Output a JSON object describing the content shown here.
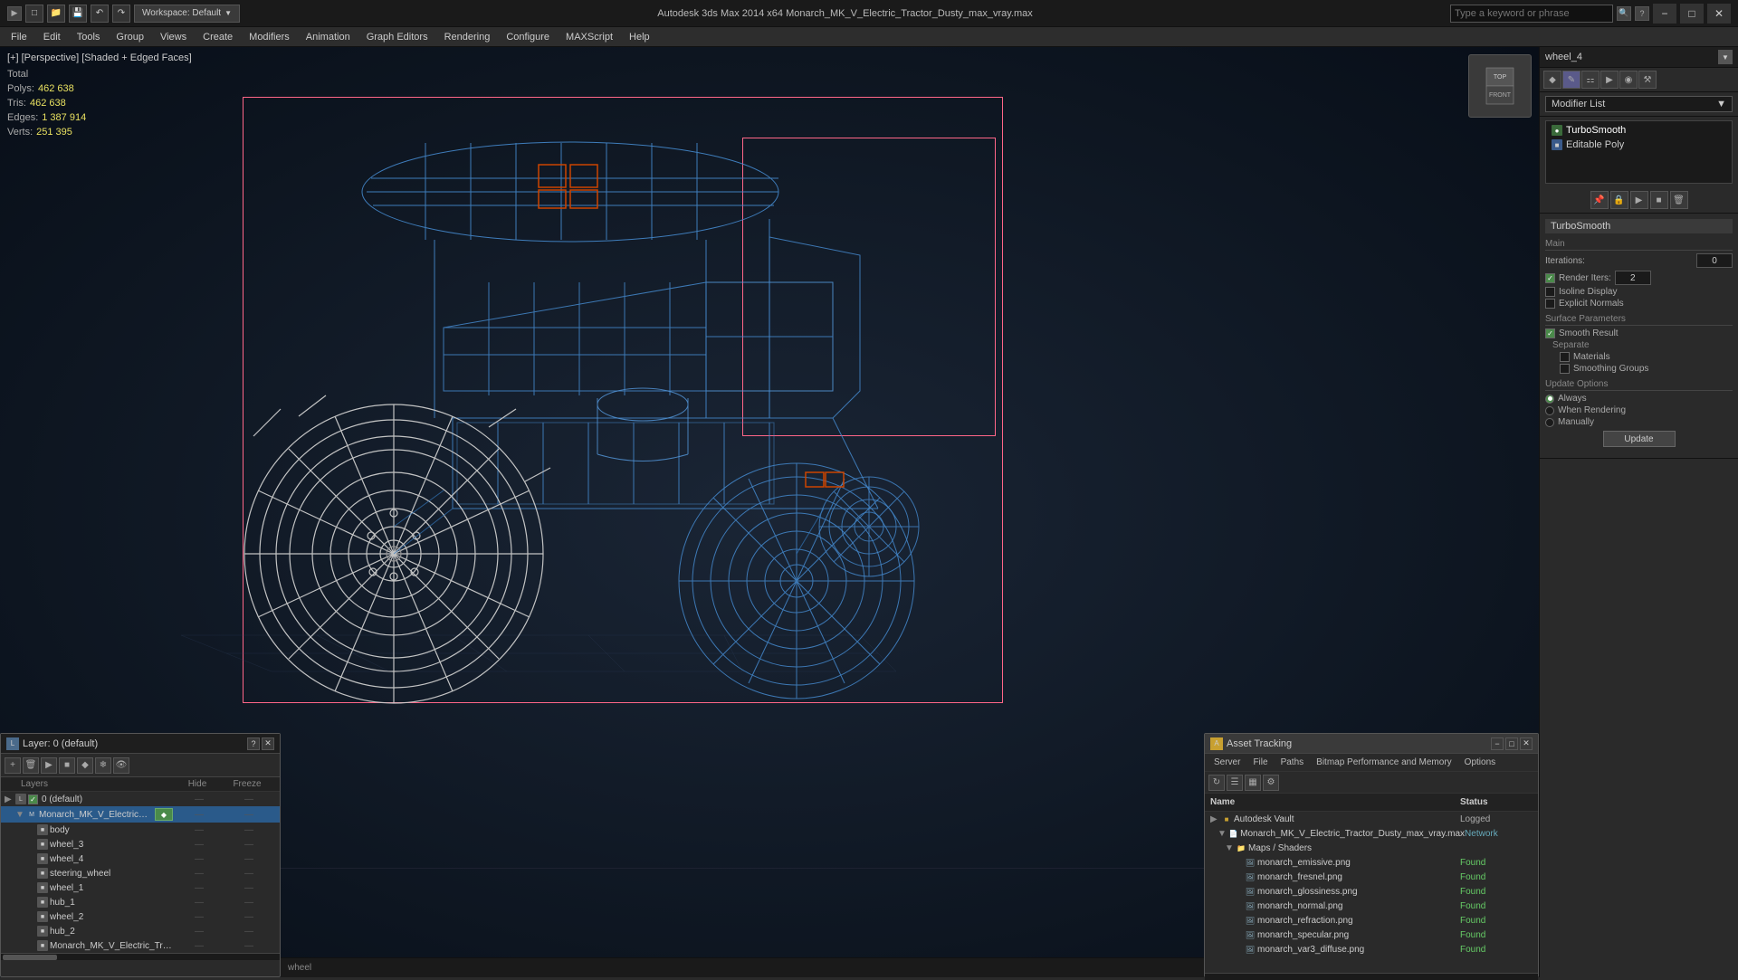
{
  "titlebar": {
    "title": "Autodesk 3ds Max 2014 x64    Monarch_MK_V_Electric_Tractor_Dusty_max_vray.max",
    "workspace_label": "Workspace: Default",
    "search_placeholder": "Type a keyword or phrase"
  },
  "menubar": {
    "items": [
      "File",
      "Edit",
      "Tools",
      "Group",
      "Views",
      "Create",
      "Modifiers",
      "Animation",
      "Graph Editors",
      "Rendering",
      "Configure",
      "MAXScript",
      "Help"
    ]
  },
  "viewport": {
    "label": "[+] [Perspective] [Shaded + Edged Faces]",
    "stats": {
      "total_label": "Total",
      "polys_label": "Polys:",
      "polys_value": "462 638",
      "tris_label": "Tris:",
      "tris_value": "462 638",
      "edges_label": "Edges:",
      "edges_value": "1 387 914",
      "verts_label": "Verts:",
      "verts_value": "251 395"
    }
  },
  "right_panel": {
    "object_name": "wheel_4",
    "modifier_list_label": "Modifier List",
    "modifiers": [
      {
        "name": "TurboSmooth",
        "type": "modifier"
      },
      {
        "name": "Editable Poly",
        "type": "base"
      }
    ],
    "turbosmooth": {
      "title": "TurboSmooth",
      "main_label": "Main",
      "iterations_label": "Iterations:",
      "iterations_value": "0",
      "render_iters_label": "Render Iters:",
      "render_iters_value": "2",
      "isoline_display_label": "Isoline Display",
      "isoline_checked": false,
      "explicit_normals_label": "Explicit Normals",
      "explicit_normals_checked": false,
      "surface_params_label": "Surface Parameters",
      "smooth_result_label": "Smooth Result",
      "smooth_result_checked": true,
      "separate_label": "Separate",
      "materials_label": "Materials",
      "materials_checked": false,
      "smoothing_groups_label": "Smoothing Groups",
      "smoothing_groups_checked": false,
      "update_options_label": "Update Options",
      "always_label": "Always",
      "always_selected": true,
      "when_rendering_label": "When Rendering",
      "when_rendering_selected": false,
      "manually_label": "Manually",
      "manually_selected": false,
      "update_btn": "Update"
    }
  },
  "layers_panel": {
    "title": "Layer: 0 (default)",
    "layers": [
      {
        "indent": 0,
        "name": "0 (default)",
        "has_check": true,
        "checked": true,
        "hide": "",
        "freeze": ""
      },
      {
        "indent": 1,
        "name": "Monarch_MK_V_Electric_Tractor_Dusty",
        "selected": true,
        "hide": "",
        "freeze": ""
      },
      {
        "indent": 2,
        "name": "body",
        "hide": "—",
        "freeze": "—"
      },
      {
        "indent": 2,
        "name": "wheel_3",
        "hide": "—",
        "freeze": "—"
      },
      {
        "indent": 2,
        "name": "wheel_4",
        "hide": "—",
        "freeze": "—"
      },
      {
        "indent": 2,
        "name": "steering_wheel",
        "hide": "—",
        "freeze": "—"
      },
      {
        "indent": 2,
        "name": "wheel_1",
        "hide": "—",
        "freeze": "—"
      },
      {
        "indent": 2,
        "name": "hub_1",
        "hide": "—",
        "freeze": "—"
      },
      {
        "indent": 2,
        "name": "wheel_2",
        "hide": "—",
        "freeze": "—"
      },
      {
        "indent": 2,
        "name": "hub_2",
        "hide": "—",
        "freeze": "—"
      },
      {
        "indent": 2,
        "name": "Monarch_MK_V_Electric_Tractor_Dusty",
        "hide": "—",
        "freeze": "—"
      }
    ],
    "col_hide": "Hide",
    "col_freeze": "Freeze"
  },
  "asset_panel": {
    "title": "Asset Tracking",
    "menus": [
      "Server",
      "File",
      "Paths",
      "Bitmap Performance and Memory",
      "Options"
    ],
    "col_name": "Name",
    "col_status": "Status",
    "assets": [
      {
        "indent": 0,
        "type": "vault",
        "name": "Autodesk Vault",
        "status": "Logged",
        "status_type": "logged"
      },
      {
        "indent": 1,
        "type": "file",
        "name": "Monarch_MK_V_Electric_Tractor_Dusty_max_vray.max",
        "status": "Network",
        "status_type": "network"
      },
      {
        "indent": 2,
        "type": "folder",
        "name": "Maps / Shaders",
        "status": "",
        "status_type": ""
      },
      {
        "indent": 3,
        "type": "image",
        "name": "monarch_emissive.png",
        "status": "Found",
        "status_type": "found"
      },
      {
        "indent": 3,
        "type": "image",
        "name": "monarch_fresnel.png",
        "status": "Found",
        "status_type": "found"
      },
      {
        "indent": 3,
        "type": "image",
        "name": "monarch_glossiness.png",
        "status": "Found",
        "status_type": "found"
      },
      {
        "indent": 3,
        "type": "image",
        "name": "monarch_normal.png",
        "status": "Found",
        "status_type": "found"
      },
      {
        "indent": 3,
        "type": "image",
        "name": "monarch_refraction.png",
        "status": "Found",
        "status_type": "found"
      },
      {
        "indent": 3,
        "type": "image",
        "name": "monarch_specular.png",
        "status": "Found",
        "status_type": "found"
      },
      {
        "indent": 3,
        "type": "image",
        "name": "monarch_var3_diffuse.png",
        "status": "Found",
        "status_type": "found"
      }
    ]
  },
  "statusbar": {
    "text": "wheel"
  }
}
